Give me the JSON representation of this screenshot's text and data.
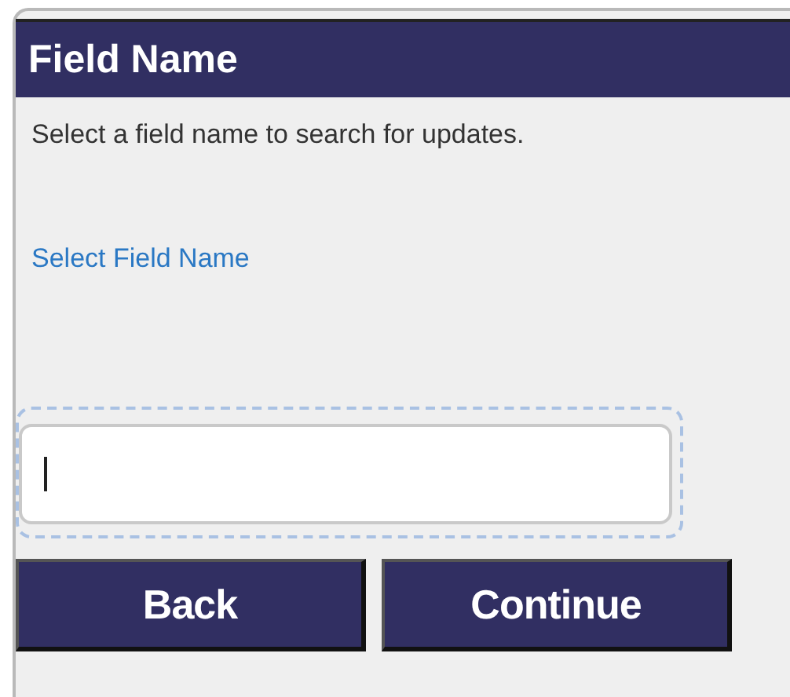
{
  "header": {
    "title": "Field Name"
  },
  "instructions": "Select a field name to search for updates.",
  "link": "Select Field Name",
  "input": {
    "focused": true
  },
  "buttons": [
    {
      "label": "Back"
    },
    {
      "label": "Continue"
    }
  ]
}
